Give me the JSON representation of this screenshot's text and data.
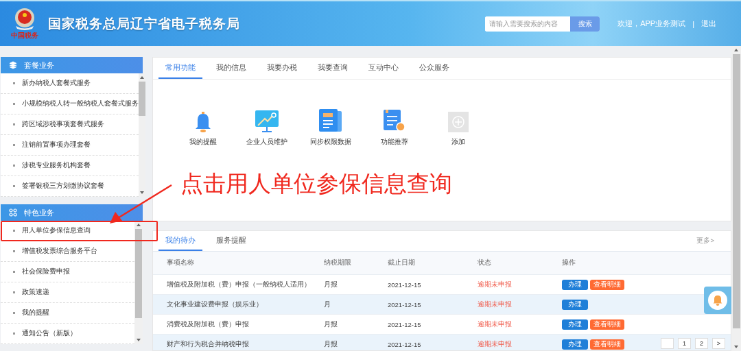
{
  "header": {
    "title": "国家税务总局辽宁省电子税务局",
    "logo_text": "中国税务",
    "search": {
      "placeholder": "请输入需要搜索的内容",
      "button": "搜索"
    },
    "welcome": "欢迎，APP业务测试",
    "separator": "|",
    "logout": "退出"
  },
  "sidebar": [
    {
      "title": "套餐业务",
      "kind": "layers",
      "items": [
        {
          "label": "新办纳税人套餐式服务",
          "highlighted": false
        },
        {
          "label": "小规模纳税人转一般纳税人套餐式服务",
          "highlighted": false
        },
        {
          "label": "跨区域涉税事项套餐式服务",
          "highlighted": false
        },
        {
          "label": "注销前置事项办理套餐",
          "highlighted": false
        },
        {
          "label": "涉税专业服务机构套餐",
          "highlighted": false
        },
        {
          "label": "签署银税三方划缴协议套餐",
          "highlighted": false
        }
      ]
    },
    {
      "title": "特色业务",
      "kind": "grid",
      "items": [
        {
          "label": "用人单位参保信息查询",
          "highlighted": true
        },
        {
          "label": "增值税发票综合服务平台",
          "highlighted": false
        },
        {
          "label": "社会保险费申报",
          "highlighted": false
        },
        {
          "label": "政策速递",
          "highlighted": false
        },
        {
          "label": "我的提醒",
          "highlighted": false
        },
        {
          "label": "通知公告（新版）",
          "highlighted": false
        }
      ]
    }
  ],
  "main_tabs": [
    {
      "label": "常用功能",
      "selected": true
    },
    {
      "label": "我的信息",
      "selected": false
    },
    {
      "label": "我要办税",
      "selected": false
    },
    {
      "label": "我要查询",
      "selected": false
    },
    {
      "label": "互动中心",
      "selected": false
    },
    {
      "label": "公众服务",
      "selected": false
    }
  ],
  "shortcuts": [
    {
      "label": "我的提醒",
      "kind": "bell"
    },
    {
      "label": "企业人员维护",
      "kind": "monitor"
    },
    {
      "label": "同步权限数据",
      "kind": "newspaper"
    },
    {
      "label": "功能推荐",
      "kind": "document"
    },
    {
      "label": "添加",
      "kind": "add"
    }
  ],
  "annotation": {
    "text": "点击用人单位参保信息查询"
  },
  "todo": {
    "tabs": [
      {
        "label": "我的待办",
        "selected": true
      },
      {
        "label": "服务提醒",
        "selected": false
      }
    ],
    "more": "更多>",
    "columns": [
      "事项名称",
      "纳税期限",
      "截止日期",
      "状态",
      "操作"
    ],
    "rows": [
      {
        "name": "增值税及附加税（费）申报（一般纳税人适用）",
        "period": "月报",
        "deadline": "2021-12-15",
        "status": "逾期未申报",
        "actions": [
          {
            "label": "办理",
            "kind": "primary"
          },
          {
            "label": "查看明细",
            "kind": "detail"
          }
        ]
      },
      {
        "name": "文化事业建设费申报（娱乐业）",
        "period": "月",
        "deadline": "2021-12-15",
        "status": "逾期未申报",
        "actions": [
          {
            "label": "办理",
            "kind": "primary"
          }
        ]
      },
      {
        "name": "消费税及附加税（费）申报",
        "period": "月报",
        "deadline": "2021-12-15",
        "status": "逾期未申报",
        "actions": [
          {
            "label": "办理",
            "kind": "primary"
          },
          {
            "label": "查看明细",
            "kind": "detail"
          }
        ]
      },
      {
        "name": "财产和行为税合并纳税申报",
        "period": "月报",
        "deadline": "2021-12-15",
        "status": "逾期未申报",
        "actions": [
          {
            "label": "办理",
            "kind": "primary"
          },
          {
            "label": "查看明细",
            "kind": "detail"
          }
        ]
      }
    ],
    "pages": [
      "1",
      "2"
    ],
    "next": ">"
  }
}
